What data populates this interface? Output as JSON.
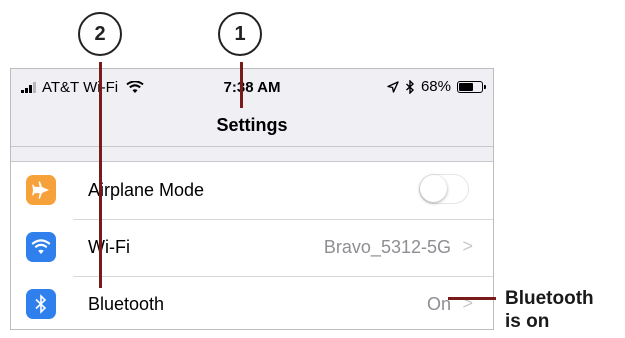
{
  "status_bar": {
    "carrier": "AT&T Wi-Fi",
    "time": "7:38 AM",
    "battery_percent": "68%",
    "battery_level": 0.68
  },
  "nav": {
    "title": "Settings"
  },
  "rows": [
    {
      "label": "Airplane Mode",
      "icon": "airplane-icon",
      "icon_color": "#f7a13b",
      "toggle_on": false
    },
    {
      "label": "Wi-Fi",
      "icon": "wifi-icon",
      "icon_color": "#2f80ed",
      "value": "Bravo_5312-5G",
      "chevron": ">"
    },
    {
      "label": "Bluetooth",
      "icon": "bluetooth-icon",
      "icon_color": "#2f80ed",
      "value": "On",
      "chevron": ">"
    }
  ],
  "callouts": {
    "one": "1",
    "two": "2",
    "bluetooth_note_line1": "Bluetooth",
    "bluetooth_note_line2": "is on"
  },
  "colors": {
    "callout_line": "#7a1b1b"
  }
}
